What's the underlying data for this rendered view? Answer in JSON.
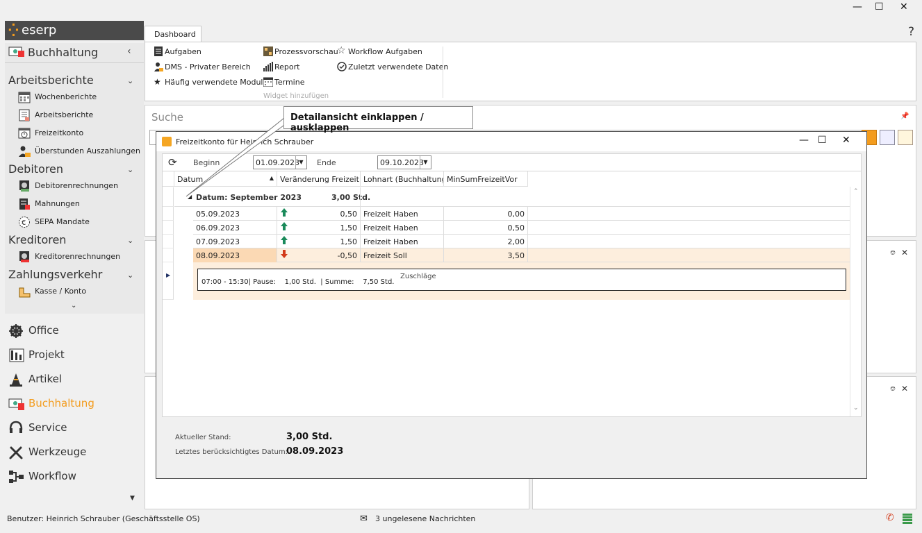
{
  "window": {
    "minimize_icon": "minimize-icon",
    "maximize_icon": "maximize-icon",
    "close_icon": "close-icon"
  },
  "logo": {
    "text": "eserp"
  },
  "sidebar": {
    "module_title": "Buchhaltung",
    "sections": [
      {
        "title": "Arbeitsberichte",
        "items": [
          {
            "label": "Wochenberichte",
            "icon": "calendar-icon"
          },
          {
            "label": "Arbeitsberichte",
            "icon": "report-icon"
          },
          {
            "label": "Freizeitkonto",
            "icon": "clock-icon"
          },
          {
            "label": "Überstunden Auszahlungen",
            "icon": "person-money-icon"
          }
        ]
      },
      {
        "title": "Debitoren",
        "items": [
          {
            "label": "Debitorenrechnungen",
            "icon": "invoice-icon"
          },
          {
            "label": "Mahnungen",
            "icon": "reminder-icon"
          },
          {
            "label": "SEPA Mandate",
            "icon": "euro-icon"
          }
        ]
      },
      {
        "title": "Kreditoren",
        "items": [
          {
            "label": "Kreditorenrechnungen",
            "icon": "invoice-icon"
          }
        ]
      },
      {
        "title": "Zahlungsverkehr",
        "items": [
          {
            "label": "Kasse / Konto",
            "icon": "cash-icon"
          }
        ]
      }
    ],
    "nav": [
      {
        "label": "Office",
        "icon": "gear-wheel-icon"
      },
      {
        "label": "Projekt",
        "icon": "building-icon"
      },
      {
        "label": "Artikel",
        "icon": "cone-icon"
      },
      {
        "label": "Buchhaltung",
        "icon": "money-icon",
        "active": true
      },
      {
        "label": "Service",
        "icon": "headset-icon"
      },
      {
        "label": "Werkzeuge",
        "icon": "tools-icon"
      },
      {
        "label": "Workflow",
        "icon": "workflow-icon"
      }
    ]
  },
  "ribbon": {
    "tab": "Dashboard",
    "buttons": {
      "aufgaben": "Aufgaben",
      "dms": "DMS - Privater Bereich",
      "haeufig": "Häufig verwendete Module",
      "prozess": "Prozessvorschau",
      "report": "Report",
      "termine": "Termine",
      "workflow_aufgaben": "Workflow Aufgaben",
      "zuletzt": "Zuletzt verwendete Daten"
    },
    "group_label": "Widget hinzufügen",
    "help": "?"
  },
  "search_panel": {
    "title": "Suche"
  },
  "dialog": {
    "title": "Freizeitkonto für Heinrich Schrauber",
    "toolbar": {
      "beginn_label": "Beginn",
      "beginn_value": "01.09.2023",
      "ende_label": "Ende",
      "ende_value": "09.10.2023"
    },
    "columns": [
      "Datum",
      "Veränderung Freizeit...",
      "Lohnart (Buchhaltung)",
      "MinSumFreizeitVor"
    ],
    "group": {
      "label": "Datum: September 2023",
      "sum": "3,00 Std."
    },
    "rows": [
      {
        "datum": "05.09.2023",
        "direction": "up",
        "veraenderung": "0,50",
        "lohnart": "Freizeit Haben",
        "minsum": "0,00"
      },
      {
        "datum": "06.09.2023",
        "direction": "up",
        "veraenderung": "1,50",
        "lohnart": "Freizeit Haben",
        "minsum": "0,50"
      },
      {
        "datum": "07.09.2023",
        "direction": "up",
        "veraenderung": "1,50",
        "lohnart": "Freizeit Haben",
        "minsum": "2,00"
      },
      {
        "datum": "08.09.2023",
        "direction": "down",
        "veraenderung": "-0,50",
        "lohnart": "Freizeit Soll",
        "minsum": "3,50"
      }
    ],
    "detail": {
      "zeit": "07:00 - 15:30| Pause:",
      "pause": "1,00 Std.",
      "summe_label": "| Summe:",
      "summe": "7,50 Std.",
      "zuschlaege": "Zuschläge"
    },
    "footer": {
      "stand_label": "Aktueller Stand:",
      "stand_value": "3,00 Std.",
      "datum_label": "Letztes berücksichtigtes Datum:",
      "datum_value": "08.09.2023"
    }
  },
  "callout": {
    "text": "Detailansicht einklappen / ausklappen"
  },
  "statusbar": {
    "user": "Benutzer: Heinrich Schrauber (Geschäftsstelle OS)",
    "messages": "3 ungelesene Nachrichten"
  },
  "colors": {
    "accent": "#f39c1e",
    "arrow_up": "#1a8a5a",
    "arrow_down": "#d23a1a",
    "selected_row": "#fdeedd"
  }
}
